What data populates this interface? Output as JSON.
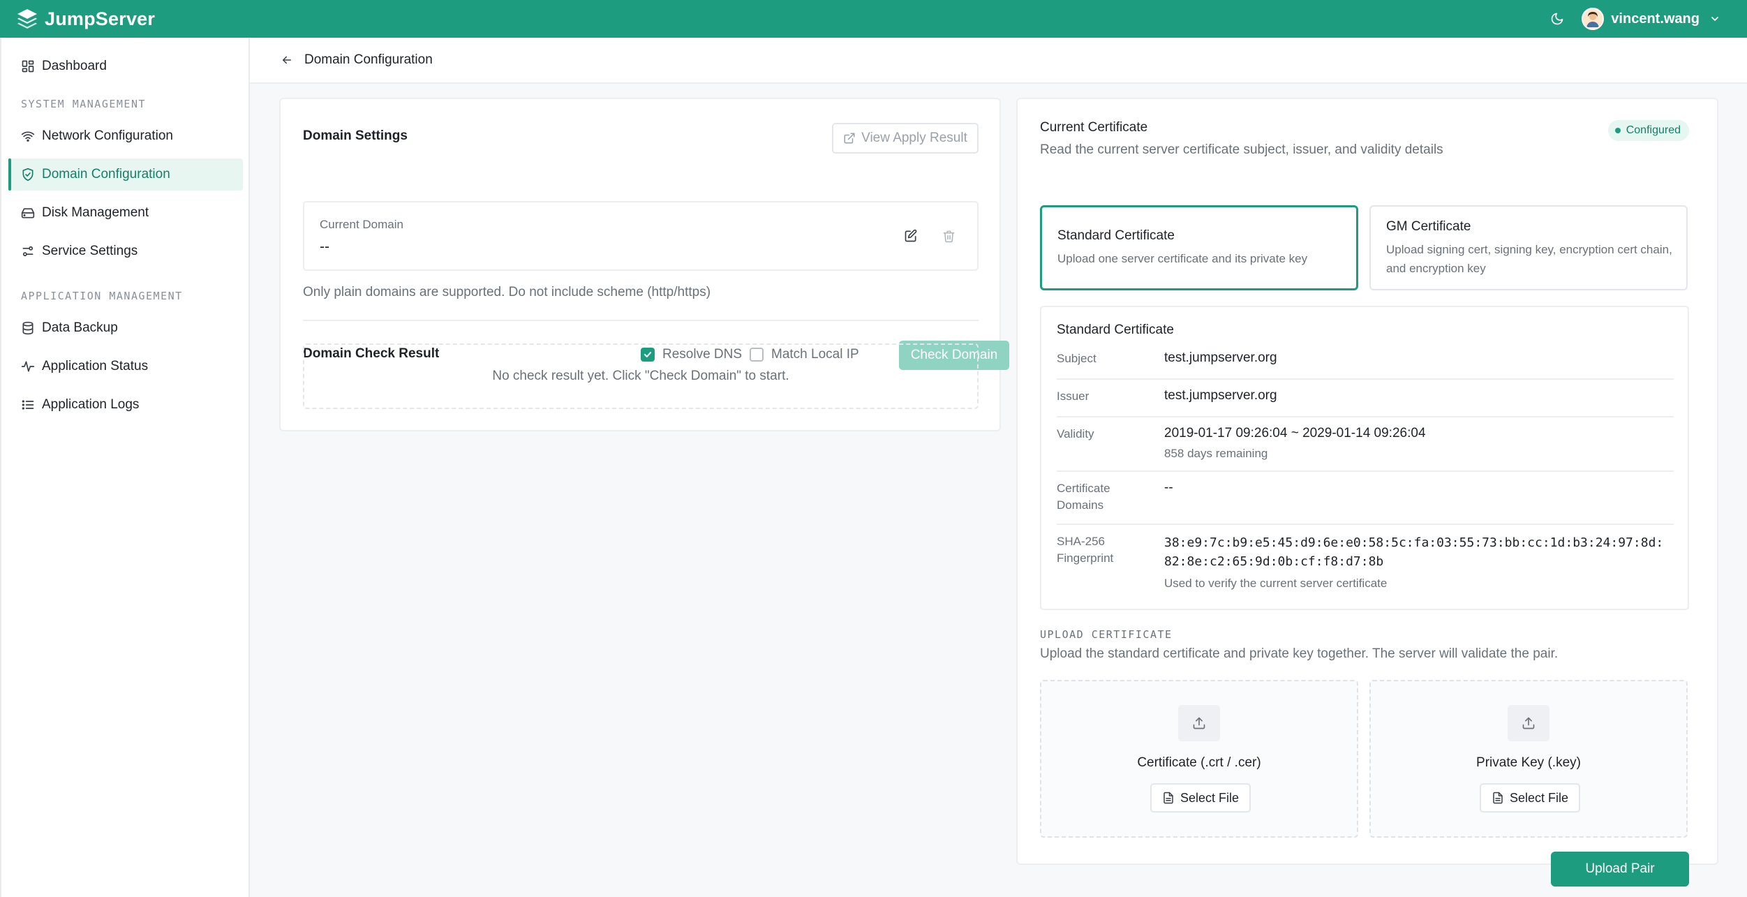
{
  "app": {
    "brand": "JumpServer"
  },
  "header": {
    "user_name": "vincent.wang"
  },
  "sidebar": {
    "dashboard": "Dashboard",
    "section_system": "SYSTEM MANAGEMENT",
    "section_application": "APPLICATION MANAGEMENT",
    "items": [
      {
        "label": "Network Configuration"
      },
      {
        "label": "Domain Configuration",
        "active": true
      },
      {
        "label": "Disk Management"
      },
      {
        "label": "Service Settings"
      },
      {
        "label": "Data Backup"
      },
      {
        "label": "Application Status"
      },
      {
        "label": "Application Logs"
      }
    ]
  },
  "breadcrumb": {
    "title": "Domain Configuration"
  },
  "domain_settings": {
    "title": "Domain Settings",
    "view_apply_result": "View Apply Result",
    "current_domain_label": "Current Domain",
    "current_domain_value": "--",
    "hint": "Only plain domains are supported. Do not include scheme (http/https)"
  },
  "domain_check": {
    "title": "Domain Check Result",
    "resolve_dns_label": "Resolve DNS",
    "resolve_dns_checked": true,
    "match_local_ip_label": "Match Local IP",
    "match_local_ip_checked": false,
    "check_button": "Check Domain",
    "empty_text": "No check result yet. Click \"Check Domain\" to start."
  },
  "certificate": {
    "title": "Current Certificate",
    "subtitle": "Read the current server certificate subject, issuer, and validity details",
    "status_badge": "Configured",
    "tiles": [
      {
        "title": "Standard Certificate",
        "desc": "Upload one server certificate and its private key",
        "active": true
      },
      {
        "title": "GM Certificate",
        "desc": "Upload signing cert, signing key, encryption cert chain, and encryption key",
        "active": false
      }
    ],
    "details": {
      "title": "Standard Certificate",
      "subject_label": "Subject",
      "subject_value": "test.jumpserver.org",
      "issuer_label": "Issuer",
      "issuer_value": "test.jumpserver.org",
      "validity_label": "Validity",
      "validity_value": "2019-01-17 09:26:04 ~ 2029-01-14 09:26:04",
      "validity_remaining": "858 days remaining",
      "domains_label": "Certificate Domains",
      "domains_value": "--",
      "fingerprint_label": "SHA-256 Fingerprint",
      "fingerprint_value": "38:e9:7c:b9:e5:45:d9:6e:e0:58:5c:fa:03:55:73:bb:cc:1d:b3:24:97:8d:82:8e:c2:65:9d:0b:cf:f8:d7:8b",
      "fingerprint_note": "Used to verify the current server certificate"
    },
    "upload": {
      "section_label": "UPLOAD CERTIFICATE",
      "description": "Upload the standard certificate and private key together. The server will validate the pair.",
      "cert_title": "Certificate (.crt / .cer)",
      "key_title": "Private Key (.key)",
      "select_file": "Select File",
      "upload_button": "Upload Pair"
    }
  },
  "colors": {
    "brand": "#1e9c7f",
    "brand_light": "#e8f6f1",
    "disabled_primary": "#8fd4c3"
  },
  "icons": [
    "layers-logo-icon",
    "moon-icon",
    "avatar-icon",
    "chevron-down-icon",
    "grid-icon",
    "wifi-icon",
    "shield-check-icon",
    "hard-drive-icon",
    "sliders-icon",
    "database-icon",
    "activity-icon",
    "list-icon",
    "arrow-left-icon",
    "external-link-icon",
    "edit-icon",
    "trash-icon",
    "check-icon",
    "upload-icon",
    "file-icon"
  ]
}
